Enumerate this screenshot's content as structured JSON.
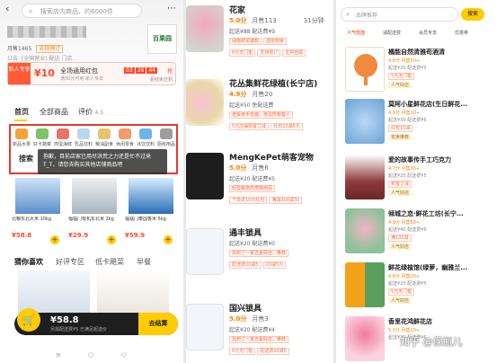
{
  "panel1": {
    "search_placeholder": "搜索店内商品，约6000件",
    "store_meta": "月售1465",
    "store_tag": "支持预订",
    "store_meta2": "公告: [全国营业] 配送 门店...",
    "logo_text": "百果园",
    "coupon": {
      "new_label": "新人专享",
      "amount": "¥10",
      "title": "全场通用红包",
      "desc": "满30元可用 新人专享",
      "timer": [
        "03",
        "26",
        "44"
      ],
      "get": "抢",
      "stock": "距结束还剩"
    },
    "tabs": [
      "首页",
      "全部商品",
      "评价"
    ],
    "rating_suffix": "4.5",
    "categories": [
      "新品水果",
      "好卡蔬菜",
      "肉蛋海鲜",
      "乳品饮料",
      "粮油副食",
      "休闲零食",
      "冰饮饮料",
      "厨房用品"
    ],
    "search_label": "搜索",
    "tip": "抱歉，目前店家已用尽洪荒之力还是忙不过来T_T，请您去购买其他店铺商品吧",
    "products": [
      {
        "name": "北粮东北大米 10kg",
        "price": "¥58.8"
      },
      {
        "name": "福临门有机东北米 2kg",
        "price": "¥29.9"
      },
      {
        "name": "福临门泰国香米 5kg",
        "price": "¥59.9"
      }
    ],
    "tabs2": [
      "猜你喜欢",
      "好评专区",
      "低卡飓菜",
      "早餐"
    ],
    "cart": {
      "total": "¥58.8",
      "sub": "另需配送费¥5 已满足起送价",
      "go": "去结算"
    },
    "nav": [
      "≡",
      "○",
      "◁"
    ]
  },
  "panel2": {
    "shops": [
      {
        "name": "花家",
        "rating": "5.0分",
        "sales": "月售113",
        "time": "31分钟",
        "fee": "起送¥88  配送费¥9",
        "tags": [
          "绿植鲜花爆款",
          "送花到家"
        ],
        "tags2": [
          "6元无门槛",
          "支持预订",
          "支持自取"
        ]
      },
      {
        "name": "花丛集鲜花绿植(长宁店)",
        "rating": "4.9分",
        "sales": "月售20",
        "time": "",
        "fee": "起送¥50  免配送费",
        "tags": [
          "老板亲手包装，惠及所有客人"
        ],
        "tags2": [
          "5元店铺新客立减",
          "红包10减5元"
        ]
      },
      {
        "name": "MengKePet萌客宠物",
        "rating": "5.0分",
        "sales": "月售6",
        "time": "",
        "fee": "起送¥20  配送费¥5",
        "tags": [
          "轻爱萌宠的宠物用品"
        ],
        "tags2": [
          "下单返10元红包",
          "满减300减30"
        ]
      },
      {
        "name": "通丰锁具",
        "rating": "",
        "sales": "",
        "time": "",
        "fee": "起送¥20  配送费¥0",
        "tags": [
          "找到了一家五金好店，推荐"
        ],
        "tags2": [
          "配送费20减5",
          "20减5元"
        ]
      },
      {
        "name": "国兴锁具",
        "rating": "5.0分",
        "sales": "月售3",
        "time": "",
        "fee": "起送¥20  配送费¥4",
        "tags": [
          "找到了一家五金好店，推荐"
        ],
        "tags2": [
          "6元无门槛",
          "配送费20减5"
        ]
      }
    ]
  },
  "panel3": {
    "search_placeholder": "品牌推荐",
    "search_button": "搜索",
    "sorts": [
      "人气优选",
      "减配送费",
      "会员专享",
      "优惠券"
    ],
    "items": [
      {
        "name": "橘能自然清雅苟酒清",
        "rate": "4.8分  月售50+",
        "fee": "起送¥20  配送费¥5",
        "tags": [
          "5元无门槛"
        ],
        "badge": "人气好店"
      },
      {
        "name": "莫阿小星鲜花店(生日鲜花...",
        "rate": "4.9分  月售10+",
        "fee": "起送¥30  配送费¥6",
        "tags": [
          "红包10减"
        ],
        "badge": "花束推荐"
      },
      {
        "name": "爱的故事传手工巧克力",
        "rate": "4.7分  月售30+",
        "fee": "起送¥20  配送费¥5",
        "tags": [
          "新客立减"
        ],
        "badge": "人气好店"
      },
      {
        "name": "倾城之恋·鲜花工坊(长宁...",
        "rate": "4.9分  月售50+",
        "fee": "起送¥40  配送费¥8",
        "tags": [
          "满100减"
        ],
        "badge": "人气好店"
      },
      {
        "name": "鲜花绿植馆(绿萝，幽雅兰...",
        "rate": "4.8分  月售20+",
        "fee": "起送¥20  配送费¥5",
        "tags": [
          "5元无门槛"
        ],
        "badge": "人气好店"
      },
      {
        "name": "香里花鸿鲜花店",
        "rate": "5.0分  月售10+",
        "fee": "起送¥30  配送费¥6",
        "tags": [
          "红包10减"
        ],
        "badge": "人气好店"
      }
    ],
    "watermark": "知乎 @保瓶儿"
  }
}
